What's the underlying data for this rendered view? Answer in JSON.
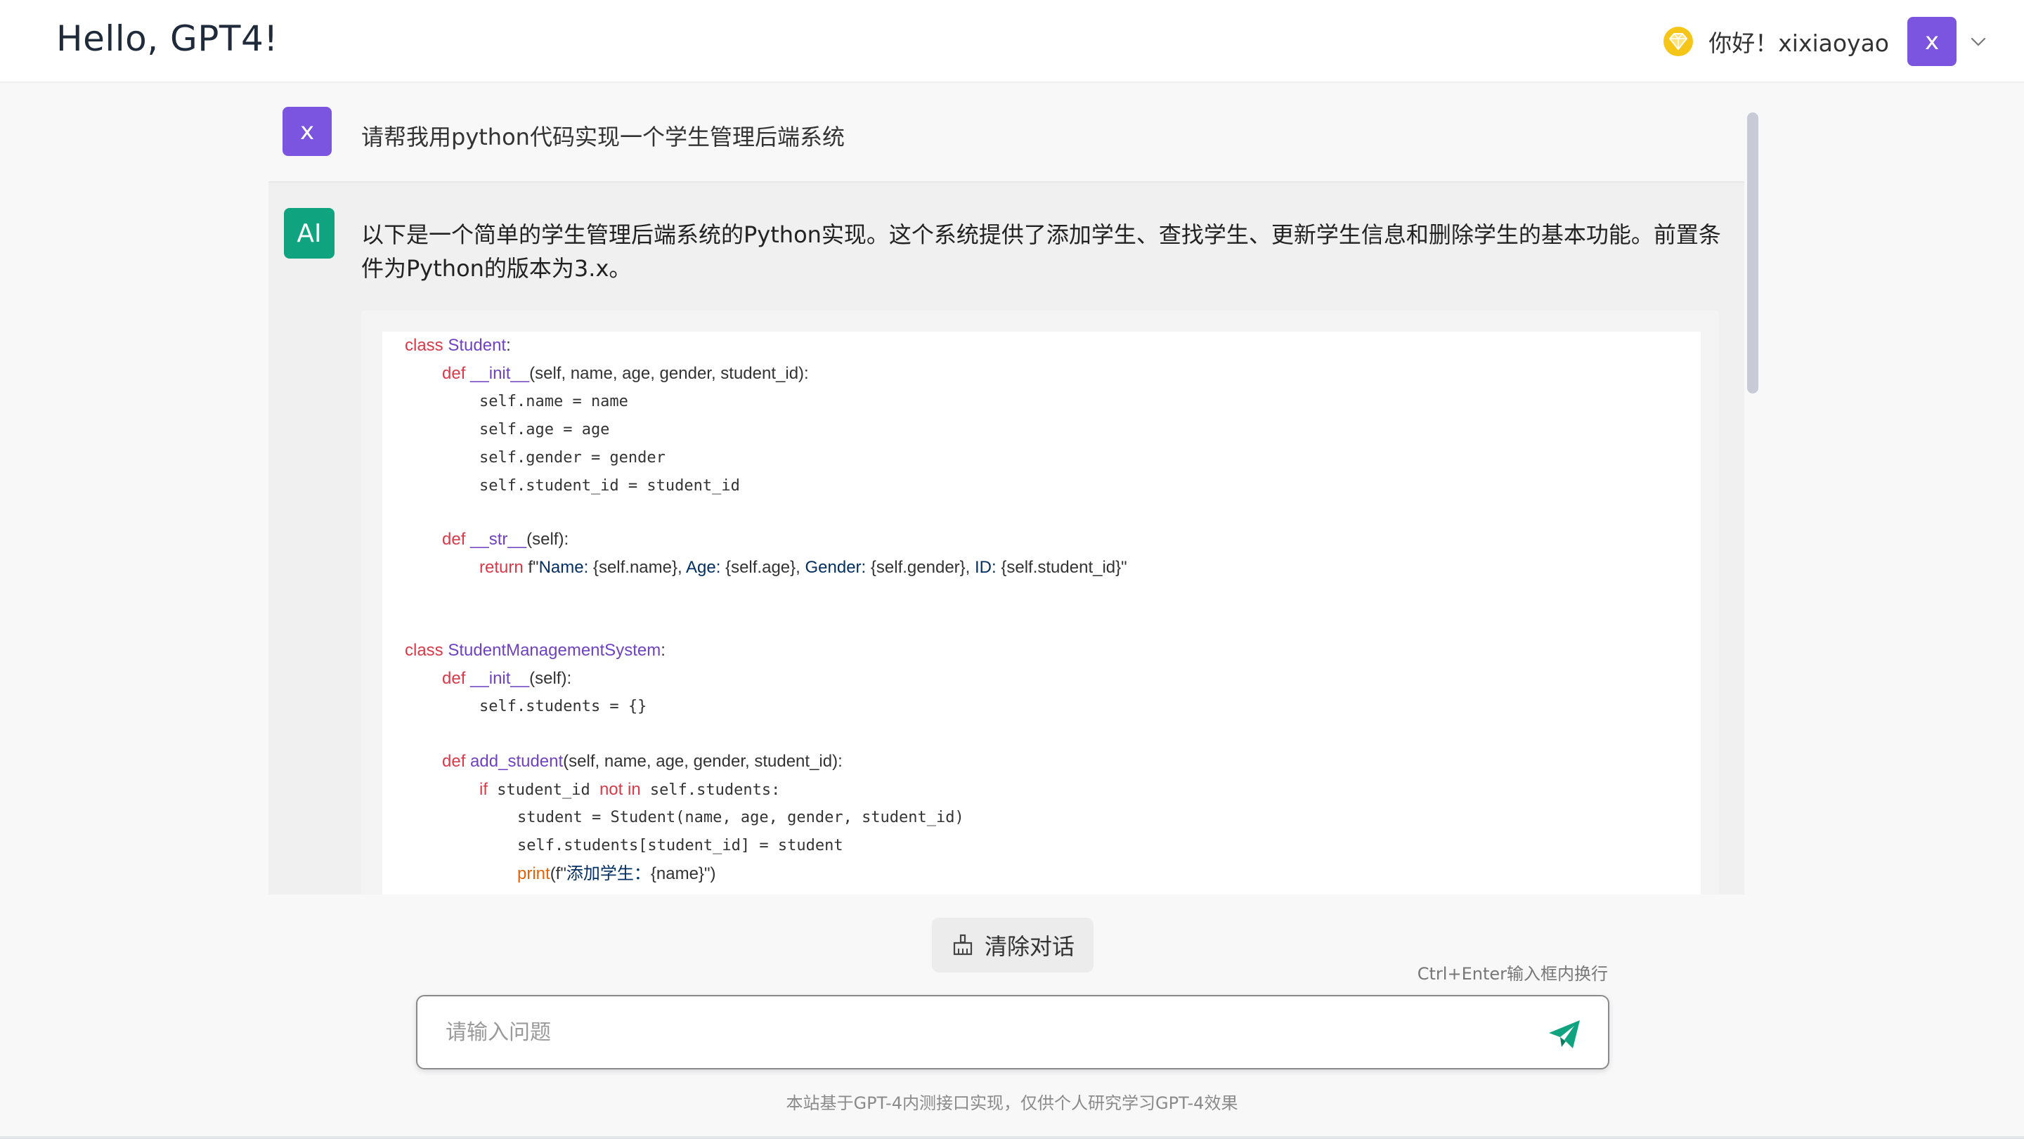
{
  "header": {
    "title": "Hello, GPT4!",
    "greeting": "你好！xixiaoyao",
    "avatar_letter": "x"
  },
  "user_message": {
    "avatar_letter": "x",
    "text": "请帮我用python代码实现一个学生管理后端系统"
  },
  "ai_message": {
    "avatar_label": "AI",
    "text": "以下是一个简单的学生管理后端系统的Python实现。这个系统提供了添加学生、查找学生、更新学生信息和删除学生的基本功能。前置条件为Python的版本为3.x。",
    "code": {
      "l1_kw": "class",
      "l1_name": "Student",
      "l1_end": ":",
      "l2_kw": "def",
      "l2_fn": "__init__",
      "l2_args": "(self, name, age, gender, student_id):",
      "l3": "self.name = name",
      "l4": "self.age = age",
      "l5": "self.gender = gender",
      "l6": "self.student_id = student_id",
      "l7_kw": "def",
      "l7_fn": "__str__",
      "l7_args": "(self):",
      "l8_kw": "return",
      "l8_pre": "f\"",
      "l8_a": "Name: ",
      "l8_b": "{self.name}, ",
      "l8_c": "Age: ",
      "l8_d": "{self.age}, ",
      "l8_e": "Gender: ",
      "l8_f": "{self.gender}, ",
      "l8_g": "ID: ",
      "l8_h": "{self.student_id}\"",
      "l9_kw": "class",
      "l9_name": "StudentManagementSystem",
      "l9_end": ":",
      "l10_kw": "def",
      "l10_fn": "__init__",
      "l10_args": "(self):",
      "l11": "self.students = {}",
      "l12_kw": "def",
      "l12_fn": "add_student",
      "l12_args": "(self, name, age, gender, student_id):",
      "l13_kw1": "if",
      "l13_mid": " student_id ",
      "l13_kw2": "not in",
      "l13_end": " self.students:",
      "l14": "student = Student(name, age, gender, student_id)",
      "l15": "self.students[student_id] = student",
      "l16_bi": "print",
      "l16_pre": "(f\"",
      "l16_str": "添加学生：",
      "l16_end": "{name}\")"
    }
  },
  "actions": {
    "clear_label": "清除对话",
    "hint": "Ctrl+Enter输入框内换行"
  },
  "input": {
    "placeholder": "请输入问题",
    "value": ""
  },
  "footer": {
    "note": "本站基于GPT-4内测接口实现，仅供个人研究学习GPT-4效果"
  },
  "colors": {
    "user_avatar": "#7b55df",
    "ai_avatar": "#10a37f",
    "send_icon": "#10a37f",
    "vip_icon": "#f5c518"
  }
}
